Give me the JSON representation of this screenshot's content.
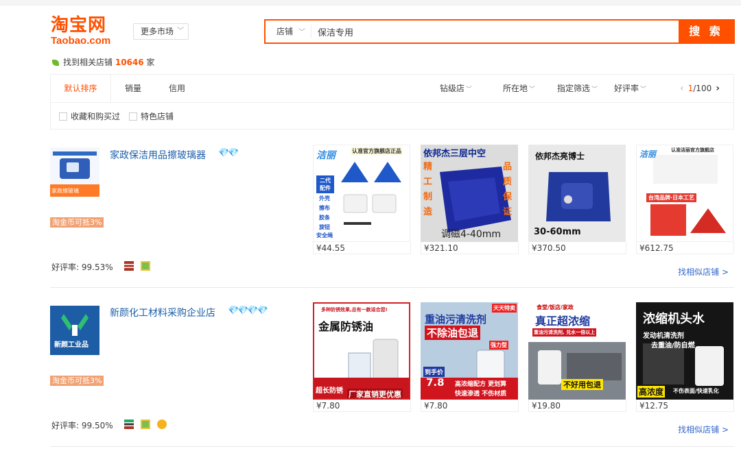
{
  "header": {
    "logo_cn": "淘宝网",
    "logo_en": "Taobao.com",
    "market_label": "更多市场",
    "search_type": "店铺",
    "search_value": "保洁专用",
    "search_button": "搜 索"
  },
  "found": {
    "prefix": "找到相关店铺",
    "count": "10646",
    "suffix": "家"
  },
  "sort_tabs": [
    "默认排序",
    "销量",
    "信用"
  ],
  "filters": [
    "钻级店",
    "所在地",
    "指定筛选",
    "好评率"
  ],
  "pager": {
    "current": "1",
    "total": "/100"
  },
  "checks": [
    "收藏和购买过",
    "特色店铺"
  ],
  "colors": {
    "accent": "#ff5000",
    "link": "#1a5ea8"
  },
  "shops": [
    {
      "name": "家政保洁用品擦玻璃器",
      "coin": "淘金币可抵3%",
      "rate": "好评率: 99.53%",
      "similar": "找相似店铺 >",
      "logo_text": "家政擦玻璃",
      "products": [
        {
          "price": "¥44.55",
          "brand": "洁丽",
          "tag": "认准官方旗舰店正品",
          "side": "二代配件",
          "parts": [
            "外壳",
            "擦布",
            "胶条",
            "旋钮",
            "安全绳"
          ]
        },
        {
          "price": "¥321.10",
          "title": "依邦杰三层中空",
          "left": "精工制造",
          "right": "品质保证",
          "bottom": "调磁4-40mm"
        },
        {
          "price": "¥370.50",
          "title": "依邦杰亮博士",
          "bottom": "30-60mm"
        },
        {
          "price": "¥612.75",
          "brand": "洁丽",
          "tag": "认准洁丽官方旗舰店",
          "red": "台湾品牌·日本工艺"
        }
      ]
    },
    {
      "name": "新颜化工材料采购企业店",
      "coin": "淘金币可抵3%",
      "rate": "好评率: 99.50%",
      "similar": "找相似店铺 >",
      "logo_text": "新颜工业品",
      "products": [
        {
          "price": "¥7.80",
          "top": "多种防锈效果,总有一款适合您!",
          "title": "金属防锈油",
          "left": "超长防锈",
          "bottom": "厂家直销更优惠"
        },
        {
          "price": "¥7.80",
          "corner": "天天特卖",
          "title": "重油污清洗剂",
          "sub": "不除油包退",
          "tag": "强力型",
          "hand": "到手价",
          "handprice": "7.8",
          "bottom1": "高浓缩配方 更划算",
          "bottom2": "快速渗透 不伤材质"
        },
        {
          "price": "¥19.80",
          "top": "食堂/饭店/家政",
          "title": "真正超浓缩",
          "sub": "重油污清洗剂, 兑水一倍以上",
          "bottom": "不好用包退"
        },
        {
          "price": "¥12.75",
          "title": "浓缩机头水",
          "sub1": "发动机清洗剂",
          "sub2": "去重油/防自燃",
          "left": "高浓度",
          "bottom": "不伤表面/快速乳化"
        }
      ]
    }
  ]
}
